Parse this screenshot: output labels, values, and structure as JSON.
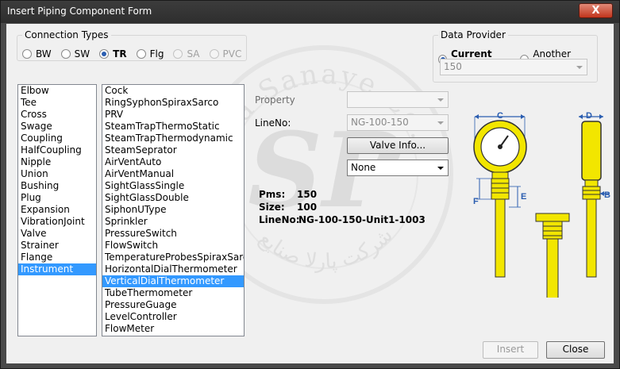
{
  "window": {
    "title": "Insert Piping Component Form",
    "close_glyph": "X"
  },
  "watermark": {
    "text_top": "Parla Sanaye Co.",
    "text_bottom": "شرکت پارلا صنایع",
    "letters": "SP"
  },
  "connection_types": {
    "label": "Connection Types",
    "options": [
      {
        "label": "BW",
        "selected": false,
        "disabled": false
      },
      {
        "label": "SW",
        "selected": false,
        "disabled": false
      },
      {
        "label": "TR",
        "selected": true,
        "disabled": false
      },
      {
        "label": "Flg",
        "selected": false,
        "disabled": false
      },
      {
        "label": "SA",
        "selected": false,
        "disabled": true
      },
      {
        "label": "PVC",
        "selected": false,
        "disabled": true
      }
    ]
  },
  "data_provider": {
    "label": "Data Provider",
    "options": [
      {
        "label": "Current Pms",
        "selected": true
      },
      {
        "label": "Another Pms",
        "selected": false
      }
    ],
    "pms_value": "150"
  },
  "categories": [
    "Elbow",
    "Tee",
    "Cross",
    "Swage",
    "Coupling",
    "HalfCoupling",
    "Nipple",
    "Union",
    "Bushing",
    "Plug",
    "Expansion",
    "VibrationJoint",
    "Valve",
    "Strainer",
    "Flange",
    "Instrument"
  ],
  "selected_category": "Instrument",
  "components": [
    "Cock",
    "RingSyphonSpiraxSarco",
    "PRV",
    "SteamTrapThermoStatic",
    "SteamTrapThermodynamic",
    "SteamSeprator",
    "AirVentAuto",
    "AirVentManual",
    "SightGlassSingle",
    "SightGlassDouble",
    "SiphonUType",
    "Sprinkler",
    "PressureSwitch",
    "FlowSwitch",
    "TemperatureProbesSpiraxSarco",
    "HorizontalDialThermometer",
    "VerticalDialThermometer",
    "TubeThermometer",
    "PressureGuage",
    "LevelController",
    "FlowMeter"
  ],
  "selected_component": "VerticalDialThermometer",
  "property": {
    "label": "Property",
    "value": ""
  },
  "lineno": {
    "label": "LineNo:",
    "value": "NG-100-150"
  },
  "valve_info_button": "Valve Info...",
  "option_combo": {
    "value": "None"
  },
  "summary": {
    "pms_label": "Pms:",
    "pms_value": "150",
    "size_label": "Size:",
    "size_value": "100",
    "lineno_label": "LineNo:",
    "lineno_value": "NG-100-150-Unit1-1003"
  },
  "diagram_labels": {
    "c": "C",
    "d": "D",
    "e": "E",
    "f": "F",
    "b": "B"
  },
  "colors": {
    "accent": "#3399ff",
    "part_fill": "#f2e600",
    "dimension": "#2a5db0"
  },
  "buttons": {
    "insert": "Insert",
    "close": "Close"
  }
}
